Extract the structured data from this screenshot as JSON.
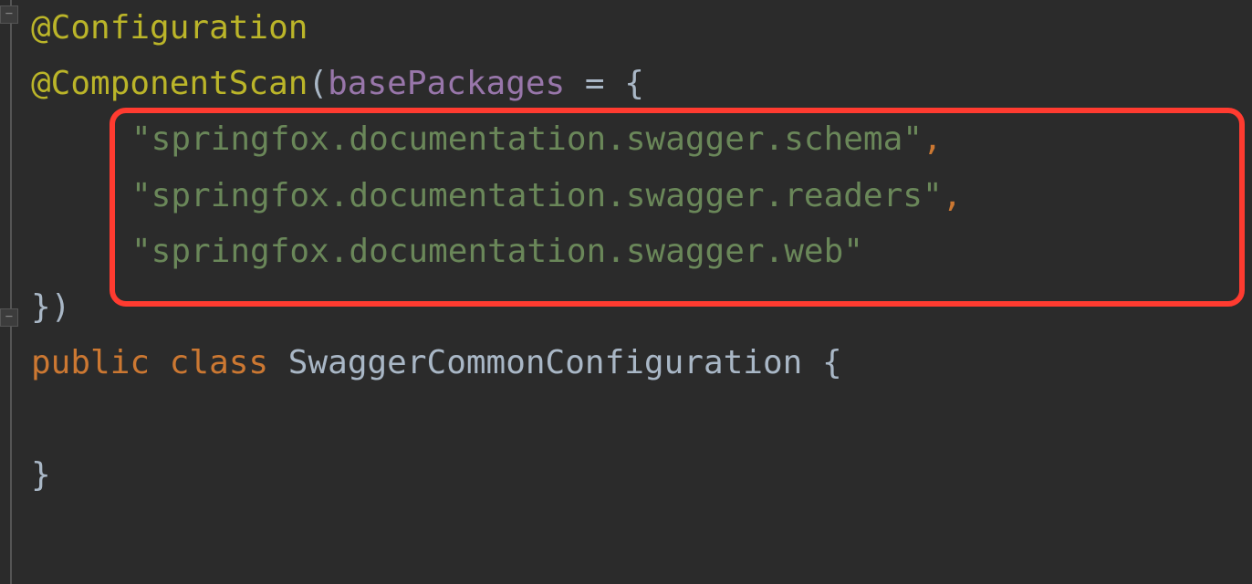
{
  "code": {
    "annotation1": "@Configuration",
    "annotation2": "@ComponentScan",
    "paramName": "basePackages",
    "pkg1": "\"springfox.documentation.swagger.schema\"",
    "pkg2": "\"springfox.documentation.swagger.readers\"",
    "pkg3": "\"springfox.documentation.swagger.web\"",
    "kw_public": "public",
    "kw_class": "class",
    "className": "SwaggerCommonConfiguration"
  }
}
